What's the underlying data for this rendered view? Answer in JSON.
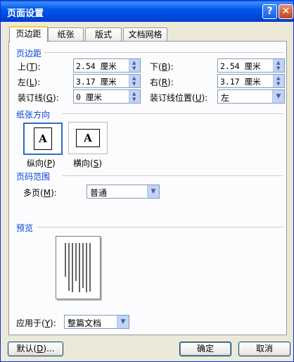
{
  "window": {
    "title": "页面设置",
    "help_glyph": "?",
    "close_glyph": "✕"
  },
  "tabs": [
    {
      "label": "页边距",
      "active": true
    },
    {
      "label": "纸张",
      "active": false
    },
    {
      "label": "版式",
      "active": false
    },
    {
      "label": "文档网格",
      "active": false
    }
  ],
  "margins": {
    "group_title": "页边距",
    "top": {
      "label": "上",
      "key": "T",
      "value": "2.54 厘米"
    },
    "bottom": {
      "label": "下",
      "key": "B",
      "value": "2.54 厘米"
    },
    "left": {
      "label": "左",
      "key": "L",
      "value": "3.17 厘米"
    },
    "right": {
      "label": "右",
      "key": "R",
      "value": "3.17 厘米"
    },
    "gutter": {
      "label": "装订线",
      "key": "G",
      "value": "0 厘米"
    },
    "gutter_pos": {
      "label": "装订线位置",
      "key": "U",
      "value": "左"
    }
  },
  "orientation": {
    "group_title": "纸张方向",
    "glyph": "A",
    "portrait": {
      "label": "纵向",
      "key": "P"
    },
    "landscape": {
      "label": "横向",
      "key": "S"
    }
  },
  "pages": {
    "group_title": "页码范围",
    "multi": {
      "label": "多页",
      "key": "M",
      "value": "普通"
    }
  },
  "preview": {
    "group_title": "预览"
  },
  "apply": {
    "label": "应用于",
    "key": "Y",
    "value": "整篇文档"
  },
  "buttons": {
    "default": {
      "label": "默认",
      "key": "D",
      "suffix": "..."
    },
    "ok": "确定",
    "cancel": "取消"
  },
  "colors": {
    "titlebar": "#0058ee",
    "group_title": "#0046d5",
    "dialog_bg": "#ece9d8"
  }
}
